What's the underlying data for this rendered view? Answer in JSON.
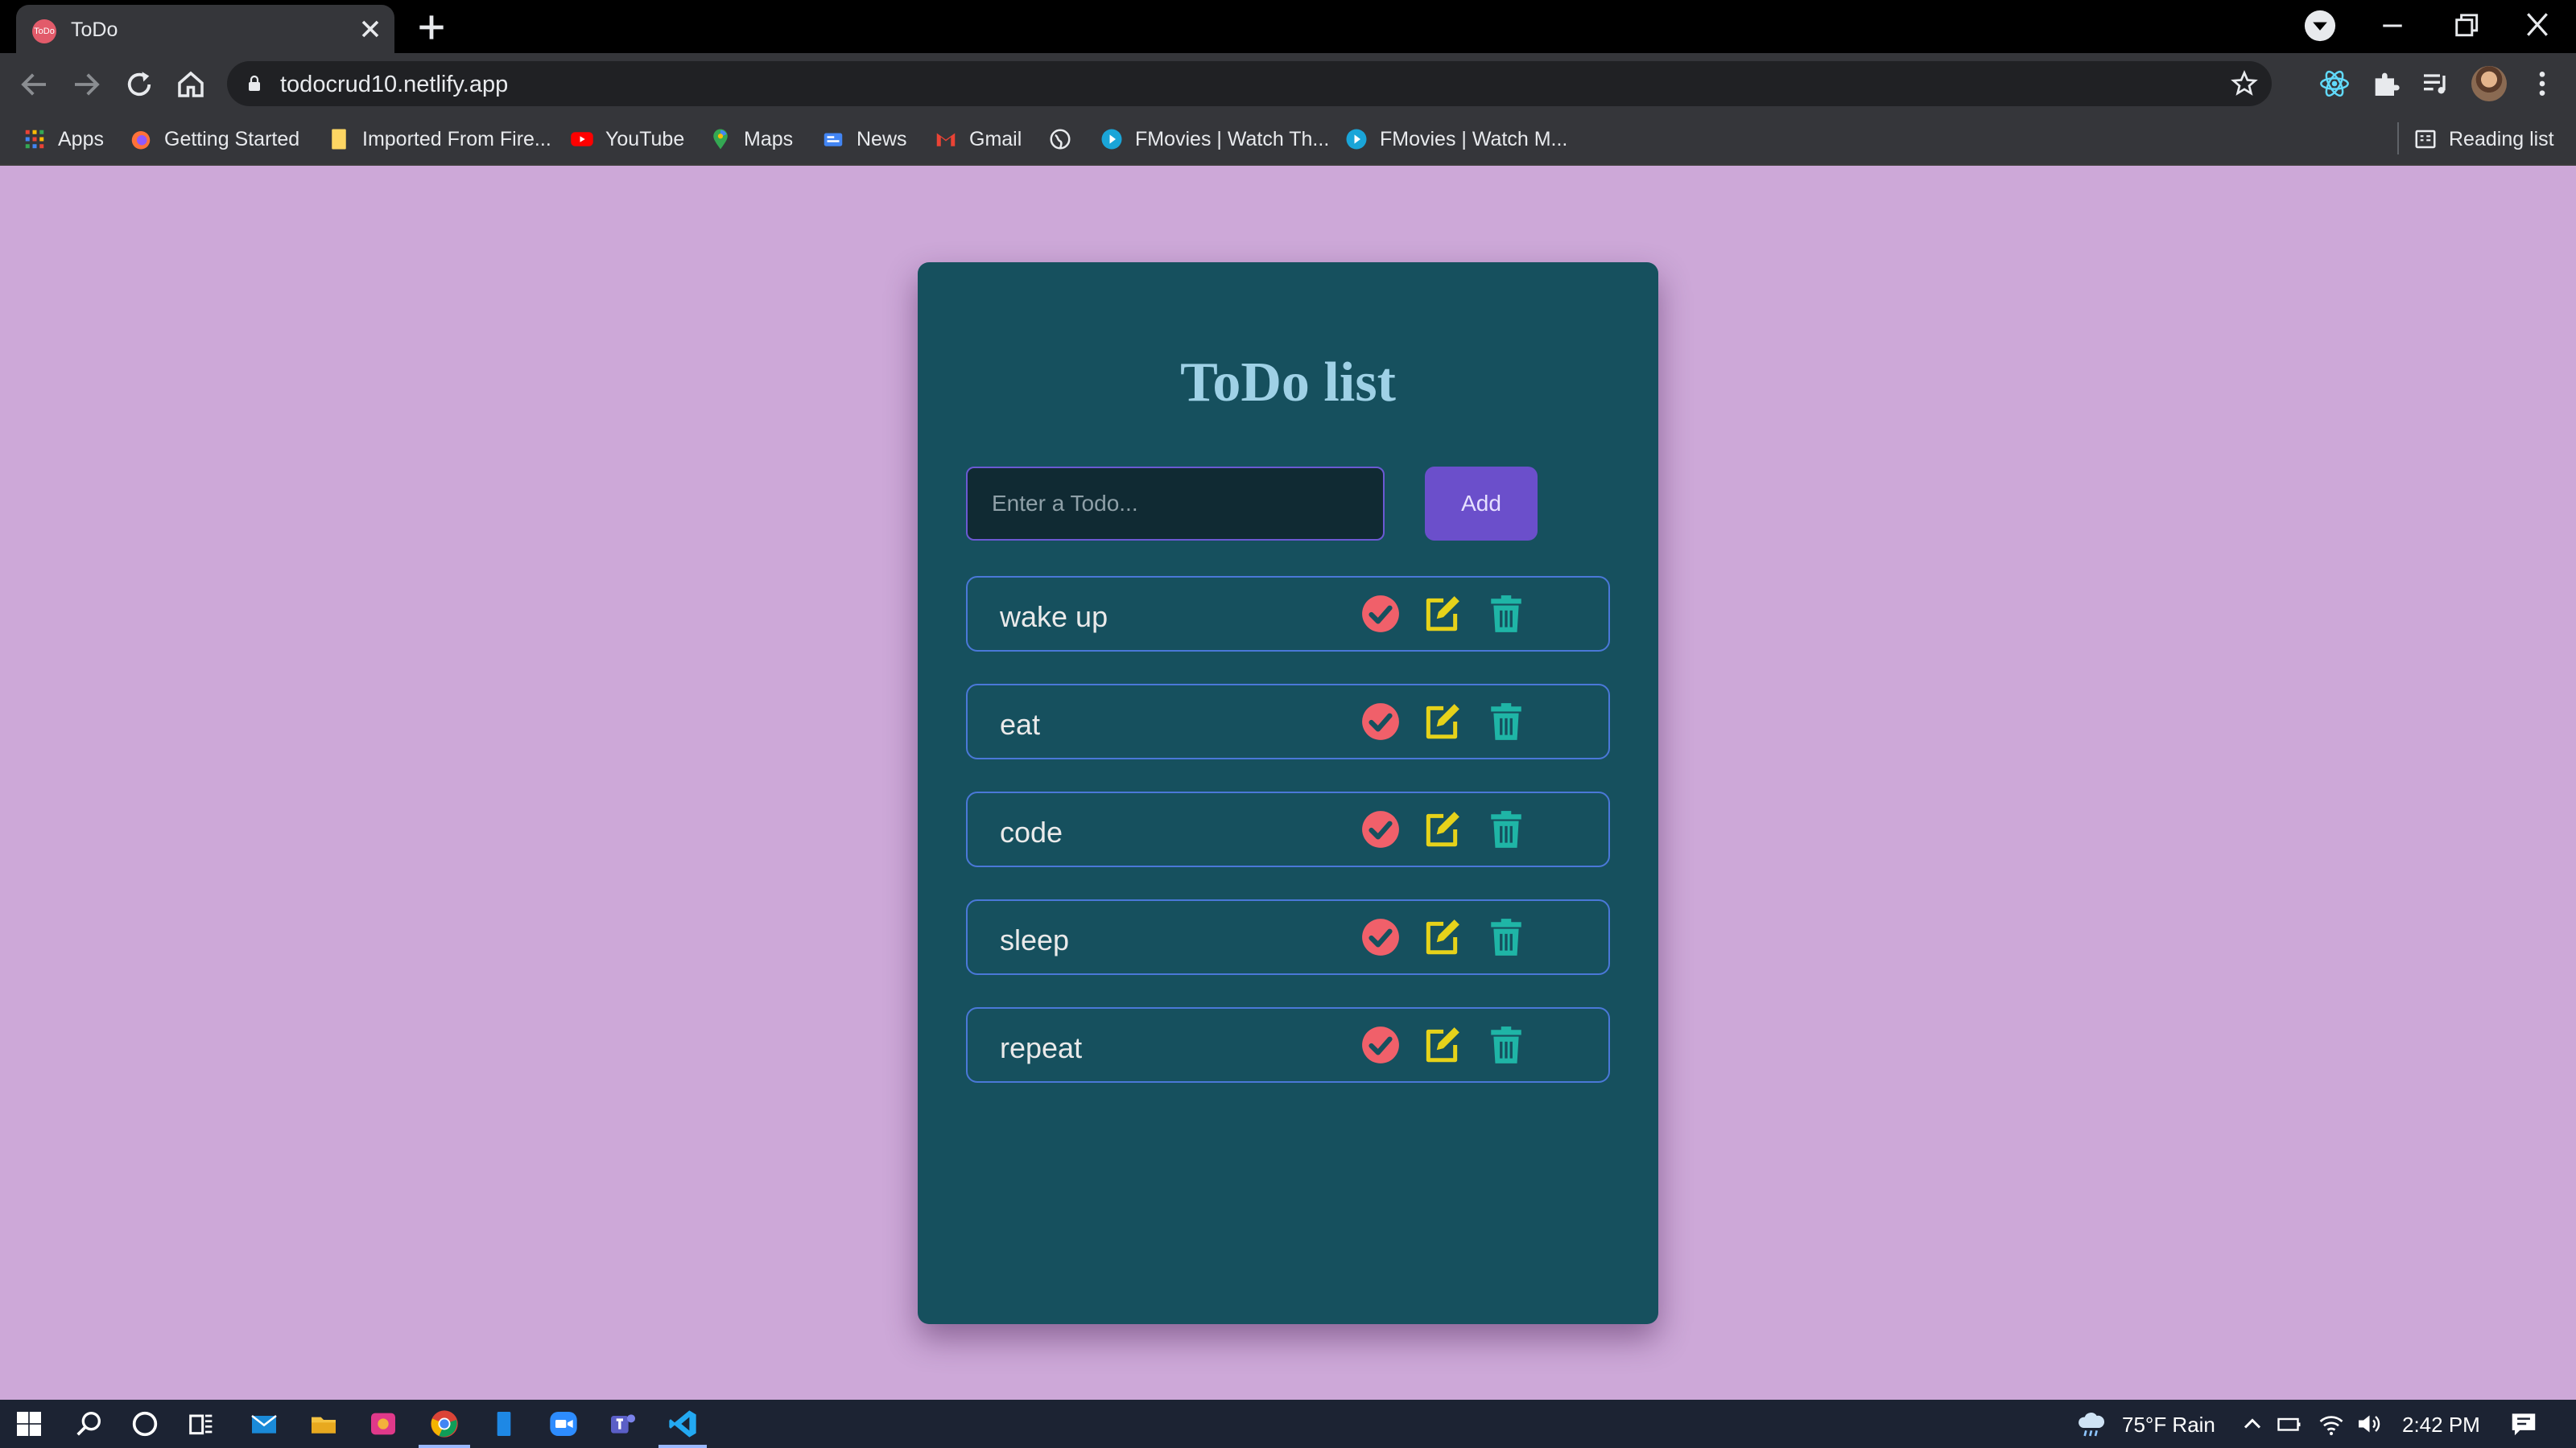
{
  "browser": {
    "tab_title": "ToDo",
    "tab_favicon_text": "ToDo",
    "url": "todocrud10.netlify.app",
    "bookmarks": [
      {
        "label": "Apps",
        "icon": "apps-grid-icon"
      },
      {
        "label": "Getting Started",
        "icon": "firefox-icon"
      },
      {
        "label": "Imported From Fire...",
        "icon": "folder-icon"
      },
      {
        "label": "YouTube",
        "icon": "youtube-icon"
      },
      {
        "label": "Maps",
        "icon": "maps-pin-icon"
      },
      {
        "label": "News",
        "icon": "news-icon"
      },
      {
        "label": "Gmail",
        "icon": "gmail-icon"
      },
      {
        "label": "",
        "icon": "globe-icon"
      },
      {
        "label": "FMovies | Watch Th...",
        "icon": "play-circle-icon"
      },
      {
        "label": "FMovies | Watch M...",
        "icon": "play-circle-icon"
      }
    ],
    "reading_list": "Reading list"
  },
  "app": {
    "title": "ToDo list",
    "input_placeholder": "Enter a Todo...",
    "add_label": "Add",
    "todos": [
      "wake up",
      "eat",
      "code",
      "sleep",
      "repeat"
    ],
    "colors": {
      "background": "#cda8d8",
      "card": "#16505e",
      "title": "#9fd1e6",
      "add_button": "#6b4fcb",
      "item_border": "#4a78d8",
      "check": "#f0606a",
      "edit": "#e6d21a",
      "delete": "#1fb5a6"
    }
  },
  "taskbar": {
    "weather": "75°F  Rain",
    "time": "2:42 PM"
  }
}
